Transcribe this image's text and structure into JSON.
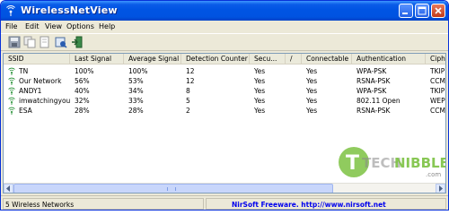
{
  "window": {
    "title": "WirelessNetView",
    "app_icon": "wifi-antenna-icon",
    "controls": [
      "minimize-icon",
      "maximize-icon",
      "close-icon"
    ]
  },
  "menu": {
    "items": [
      "File",
      "Edit",
      "View",
      "Options",
      "Help"
    ]
  },
  "toolbar": {
    "buttons": [
      "save-icon",
      "copy-icon",
      "html-report-icon",
      "properties-icon",
      "exit-icon"
    ]
  },
  "list": {
    "columns": [
      "SSID",
      "Last Signal",
      "Average Signal",
      "Detection Counter",
      "Secu...",
      "/",
      "Connectable",
      "Authentication",
      "Ciphe"
    ],
    "rows": [
      {
        "ssid": "TN",
        "last_signal": "100%",
        "avg_signal": "100%",
        "detection": "12",
        "security": "Yes",
        "connectable": "Yes",
        "authentication": "WPA-PSK",
        "cipher": "TKIP"
      },
      {
        "ssid": "Our Network",
        "last_signal": "56%",
        "avg_signal": "53%",
        "detection": "12",
        "security": "Yes",
        "connectable": "Yes",
        "authentication": "RSNA-PSK",
        "cipher": "CCMP"
      },
      {
        "ssid": "ANDY1",
        "last_signal": "40%",
        "avg_signal": "34%",
        "detection": "8",
        "security": "Yes",
        "connectable": "Yes",
        "authentication": "WPA-PSK",
        "cipher": "TKIP"
      },
      {
        "ssid": "imwatchingyou",
        "last_signal": "32%",
        "avg_signal": "33%",
        "detection": "5",
        "security": "Yes",
        "connectable": "Yes",
        "authentication": "802.11 Open",
        "cipher": "WEP"
      },
      {
        "ssid": "ESA",
        "last_signal": "28%",
        "avg_signal": "28%",
        "detection": "2",
        "security": "Yes",
        "connectable": "Yes",
        "authentication": "RSNA-PSK",
        "cipher": "CCMP"
      }
    ],
    "row_icon": "wifi-signal-icon"
  },
  "watermark": {
    "brand_part1": "TECH",
    "brand_part2": "NIBBLE",
    "domain": ".com"
  },
  "status": {
    "count": "5 Wireless Networks",
    "link": "NirSoft Freeware.  http://www.nirsoft.net"
  },
  "colors": {
    "titlebar": "#0054e3",
    "link": "#0000ee",
    "watermark_green": "#7cc242"
  }
}
